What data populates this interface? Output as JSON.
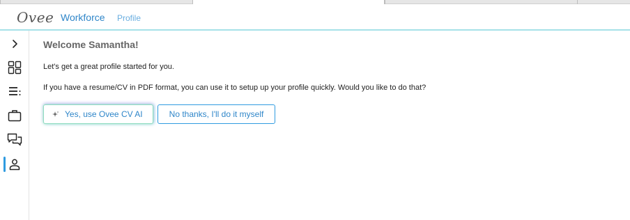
{
  "header": {
    "logo": "Ovee",
    "nav_workforce": "Workforce",
    "nav_profile": "Profile"
  },
  "sidebar": {
    "items": [
      {
        "icon": "chevron-right-icon"
      },
      {
        "icon": "dashboard-grid-icon"
      },
      {
        "icon": "list-icon"
      },
      {
        "icon": "briefcase-icon"
      },
      {
        "icon": "chat-bubbles-icon"
      },
      {
        "icon": "person-icon",
        "active": true
      }
    ],
    "accent_color": "#2f9be0"
  },
  "main": {
    "welcome": "Welcome Samantha!",
    "intro": "Let's get a great profile started for you.",
    "question": "If you have a resume/CV in PDF format, you can use it to setup up your profile quickly. Would you like to do that?",
    "ai_button_label": "Yes, use Ovee CV AI",
    "decline_button_label": "No thanks, I'll do it myself"
  },
  "colors": {
    "link": "#2f86c9",
    "header_line": "#a6e1e8"
  }
}
